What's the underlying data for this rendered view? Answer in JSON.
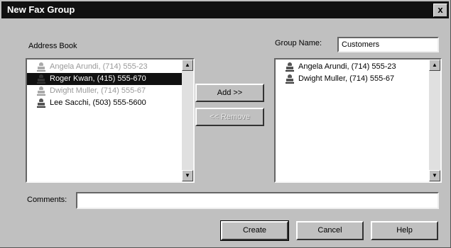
{
  "window": {
    "title": "New Fax Group",
    "close_glyph": "x"
  },
  "address_book": {
    "label": "Address Book",
    "items": [
      {
        "name": "Angela Arundi, (714) 555-23",
        "state": "dim",
        "icon": "person-icon"
      },
      {
        "name": "Roger Kwan, (415) 555-670",
        "state": "selected",
        "icon": "person-icon"
      },
      {
        "name": "Dwight Muller, (714) 555-67",
        "state": "dim",
        "icon": "person-icon"
      },
      {
        "name": "Lee Sacchi, (503) 555-5600",
        "state": "normal",
        "icon": "person-icon"
      }
    ]
  },
  "group": {
    "name_label": "Group Name:",
    "name_value": "Customers",
    "items": [
      {
        "name": "Angela Arundi, (714) 555-23",
        "icon": "person-icon"
      },
      {
        "name": "Dwight Muller, (714) 555-67",
        "icon": "person-icon"
      }
    ]
  },
  "actions": {
    "add_label": "Add >>",
    "remove_label": "<< Remove",
    "remove_enabled": false
  },
  "comments": {
    "label": "Comments:",
    "value": ""
  },
  "footer": {
    "create_label": "Create",
    "cancel_label": "Cancel",
    "help_label": "Help"
  },
  "scroll_glyphs": {
    "up": "▲",
    "down": "▼"
  }
}
